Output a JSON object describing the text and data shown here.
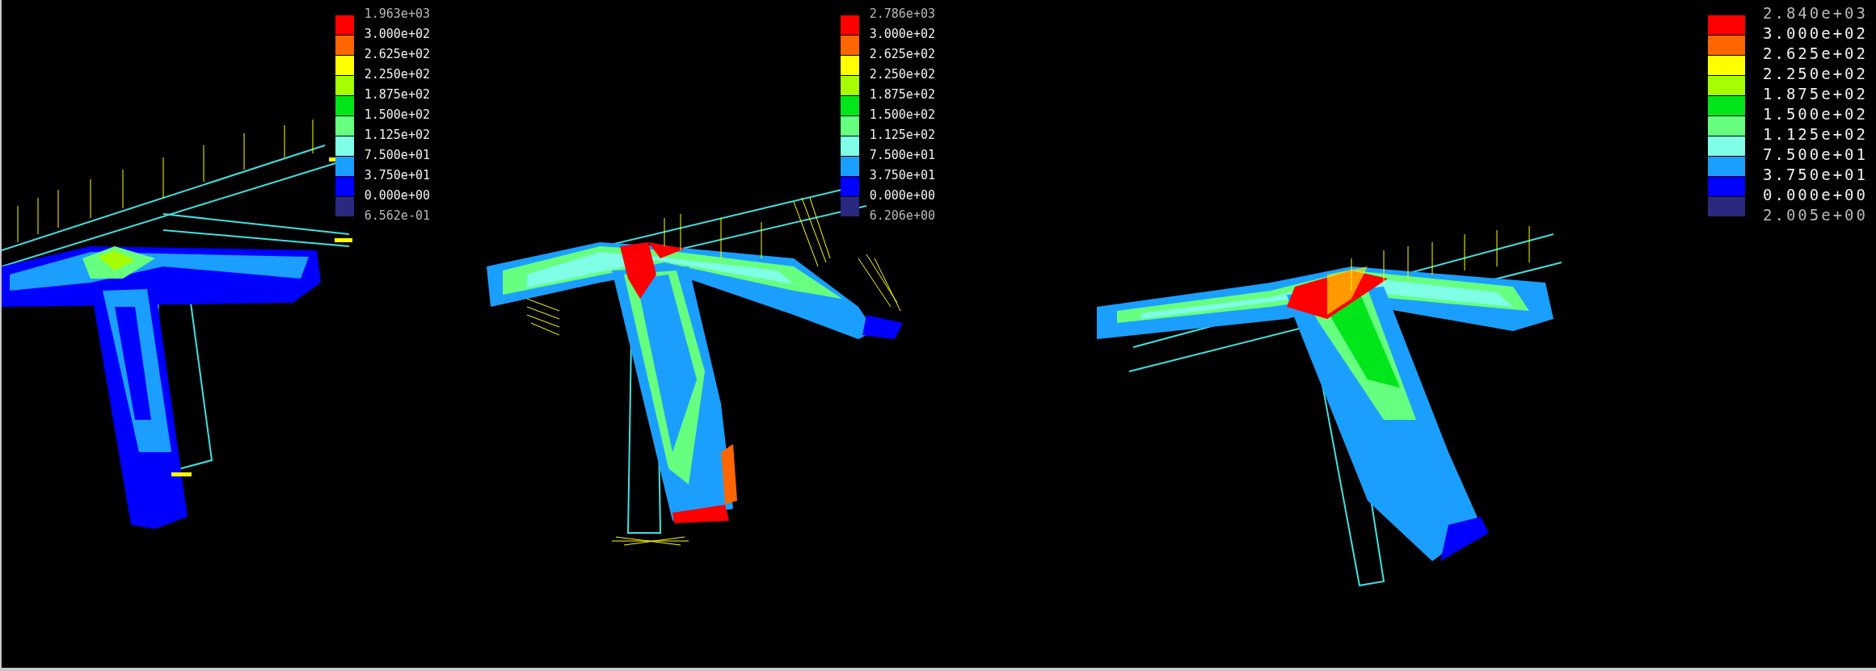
{
  "viewports": [
    {
      "legend": {
        "labels": [
          "1.963e+03",
          "3.000e+02",
          "2.625e+02",
          "2.250e+02",
          "1.875e+02",
          "1.500e+02",
          "1.125e+02",
          "7.500e+01",
          "3.750e+01",
          "0.000e+00",
          "6.562e-01"
        ],
        "swatches": [
          {
            "color": "#ff0000"
          },
          {
            "color": "#ff6600"
          },
          {
            "color": "#ffff00"
          },
          {
            "color": "#a6ff00"
          },
          {
            "color": "#00e61a"
          },
          {
            "color": "#66ff80"
          },
          {
            "color": "#80ffe6"
          },
          {
            "color": "#1a9fff"
          },
          {
            "color": "#0000ff"
          },
          {
            "color": "#29297f"
          }
        ]
      }
    },
    {
      "legend": {
        "labels": [
          "2.786e+03",
          "3.000e+02",
          "2.625e+02",
          "2.250e+02",
          "1.875e+02",
          "1.500e+02",
          "1.125e+02",
          "7.500e+01",
          "3.750e+01",
          "0.000e+00",
          "6.206e+00"
        ],
        "swatches": [
          {
            "color": "#ff0000"
          },
          {
            "color": "#ff6600"
          },
          {
            "color": "#ffff00"
          },
          {
            "color": "#a6ff00"
          },
          {
            "color": "#00e61a"
          },
          {
            "color": "#66ff80"
          },
          {
            "color": "#80ffe6"
          },
          {
            "color": "#1a9fff"
          },
          {
            "color": "#0000ff"
          },
          {
            "color": "#29297f"
          }
        ]
      }
    },
    {
      "legend": {
        "labels": [
          "2.840e+03",
          "3.000e+02",
          "2.625e+02",
          "2.250e+02",
          "1.875e+02",
          "1.500e+02",
          "1.125e+02",
          "7.500e+01",
          "3.750e+01",
          "0.000e+00",
          "2.005e+00"
        ],
        "swatches": [
          {
            "color": "#ff0000"
          },
          {
            "color": "#ff6600"
          },
          {
            "color": "#ffff00"
          },
          {
            "color": "#a6ff00"
          },
          {
            "color": "#00e61a"
          },
          {
            "color": "#66ff80"
          },
          {
            "color": "#80ffe6"
          },
          {
            "color": "#1a9fff"
          },
          {
            "color": "#0000ff"
          },
          {
            "color": "#29297f"
          }
        ]
      }
    }
  ]
}
